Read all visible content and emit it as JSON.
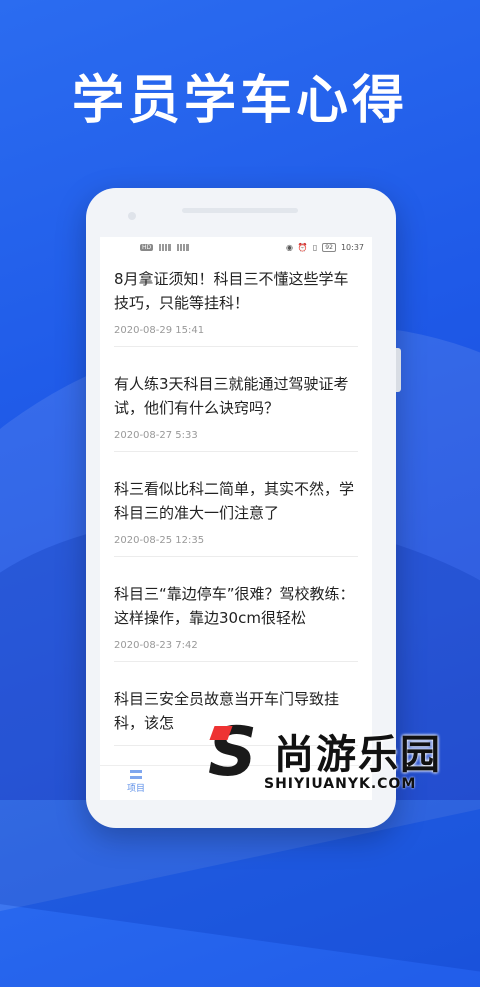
{
  "headline": "学员学车心得",
  "statusbar": {
    "left_icons": [
      "HD",
      "signal",
      "signal"
    ],
    "battery": "92",
    "time": "10:37"
  },
  "articles": [
    {
      "title": "8月拿证须知！科目三不懂这些学车技巧，只能等挂科！",
      "date": "2020-08-29 15:41"
    },
    {
      "title": "有人练3天科目三就能通过驾驶证考试，他们有什么诀窍吗？",
      "date": "2020-08-27 5:33"
    },
    {
      "title": "科三看似比科二简单，其实不然，学科目三的准大一们注意了",
      "date": "2020-08-25 12:35"
    },
    {
      "title": "科目三“靠边停车”很难？驾校教练：这样操作，靠边30cm很轻松",
      "date": "2020-08-23 7:42"
    },
    {
      "title": "科目三安全员故意当开车门导致挂科，该怎",
      "date": ""
    }
  ],
  "tabbar": {
    "tab1_label": "项目",
    "tab1_icon": "list-icon"
  },
  "watermark": {
    "brand": "尚游乐园",
    "url": "SHIYIUANYK.COM",
    "logo_letter": "S"
  }
}
